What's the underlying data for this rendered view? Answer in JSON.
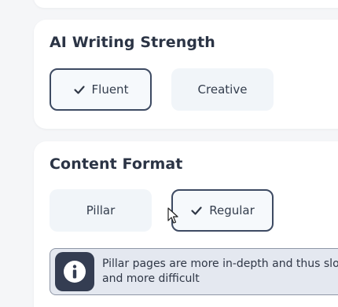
{
  "strength_section": {
    "title": "AI Writing Strength",
    "options": [
      {
        "label": "Fluent",
        "selected": true
      },
      {
        "label": "Creative",
        "selected": false
      }
    ]
  },
  "format_section": {
    "title": "Content Format",
    "options": [
      {
        "label": "Pillar",
        "selected": false
      },
      {
        "label": "Regular",
        "selected": true
      }
    ],
    "info": {
      "icon": "info-icon",
      "text": "Pillar pages are more in-depth and thus slower and more difficult"
    }
  },
  "colors": {
    "page_bg": "#f5f6f8",
    "card_bg": "#ffffff",
    "option_bg": "#f1f5f9",
    "selected_border": "#3d4a62",
    "info_bg": "#e4e8f0",
    "info_icon_bg": "#343d52",
    "text": "#2b3445"
  }
}
